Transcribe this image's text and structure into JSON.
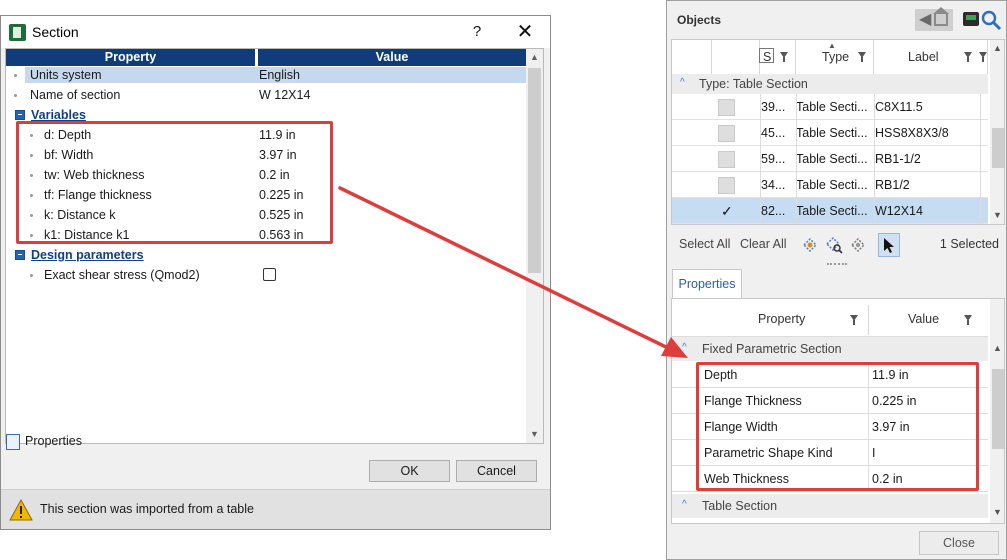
{
  "dialog": {
    "title": "Section",
    "help_label": "?",
    "close_label": "✕",
    "columns": {
      "property": "Property",
      "value": "Value"
    },
    "rows": [
      {
        "name": "Units system",
        "value": "English"
      },
      {
        "name": "Name of section",
        "value": "W 12X14"
      }
    ],
    "groups": [
      {
        "label": "Variables",
        "rows": [
          {
            "name": "d: Depth",
            "value": "11.9 in"
          },
          {
            "name": "bf: Width",
            "value": "3.97 in"
          },
          {
            "name": "tw: Web thickness",
            "value": "0.2 in"
          },
          {
            "name": "tf: Flange thickness",
            "value": "0.225 in"
          },
          {
            "name": "k: Distance k",
            "value": "0.525 in"
          },
          {
            "name": "k1: Distance k1",
            "value": "0.563 in"
          }
        ]
      },
      {
        "label": "Design parameters",
        "rows": [
          {
            "name": "Exact shear stress (Qmod2)",
            "checked": false
          }
        ]
      }
    ],
    "footer_label": "Properties",
    "ok_label": "OK",
    "cancel_label": "Cancel",
    "status_message": "This section was imported from a table"
  },
  "objects": {
    "title": "Objects",
    "columns": {
      "s": "S",
      "type": "Type",
      "label": "Label"
    },
    "group_label": "Type: Table Section",
    "rows": [
      {
        "s": "39...",
        "type": "Table Secti...",
        "label": "C8X11.5",
        "checked": false,
        "selected": false
      },
      {
        "s": "45...",
        "type": "Table Secti...",
        "label": "HSS8X8X3/8",
        "checked": false,
        "selected": false
      },
      {
        "s": "59...",
        "type": "Table Secti...",
        "label": "RB1-1/2",
        "checked": false,
        "selected": false
      },
      {
        "s": "34...",
        "type": "Table Secti...",
        "label": "RB1/2",
        "checked": false,
        "selected": false
      },
      {
        "s": "82...",
        "type": "Table Secti...",
        "label": "W12X14",
        "checked": true,
        "selected": true
      }
    ],
    "select_all_label": "Select All",
    "clear_all_label": "Clear All",
    "selected_count": "1 Selected",
    "check_mark": "✓"
  },
  "properties": {
    "tab_label": "Properties",
    "columns": {
      "property": "Property",
      "value": "Value"
    },
    "group1_label": "Fixed Parametric Section",
    "rows": [
      {
        "name": "Depth",
        "value": "11.9 in"
      },
      {
        "name": "Flange Thickness",
        "value": "0.225 in"
      },
      {
        "name": "Flange Width",
        "value": "3.97 in"
      },
      {
        "name": "Parametric Shape Kind",
        "value": "I"
      },
      {
        "name": "Web Thickness",
        "value": "0.2 in"
      }
    ],
    "group2_label": "Table Section",
    "close_label": "Close"
  },
  "colors": {
    "header_blue": "#103d7a",
    "selection_blue": "#c6dcf2",
    "annotation_red": "#de3d3d",
    "link_blue": "#2b5ea4"
  },
  "icons": {
    "dialog": [
      "section-app-icon",
      "help-icon",
      "close-icon",
      "collapse-group-icon",
      "properties-icon",
      "warning-icon"
    ],
    "objects": [
      "back-home-icon",
      "export-icon",
      "search-icon",
      "filter-icon",
      "sort-ascending-icon",
      "collapse-caret-icon",
      "select-tool-icon",
      "pointer-icon"
    ]
  }
}
